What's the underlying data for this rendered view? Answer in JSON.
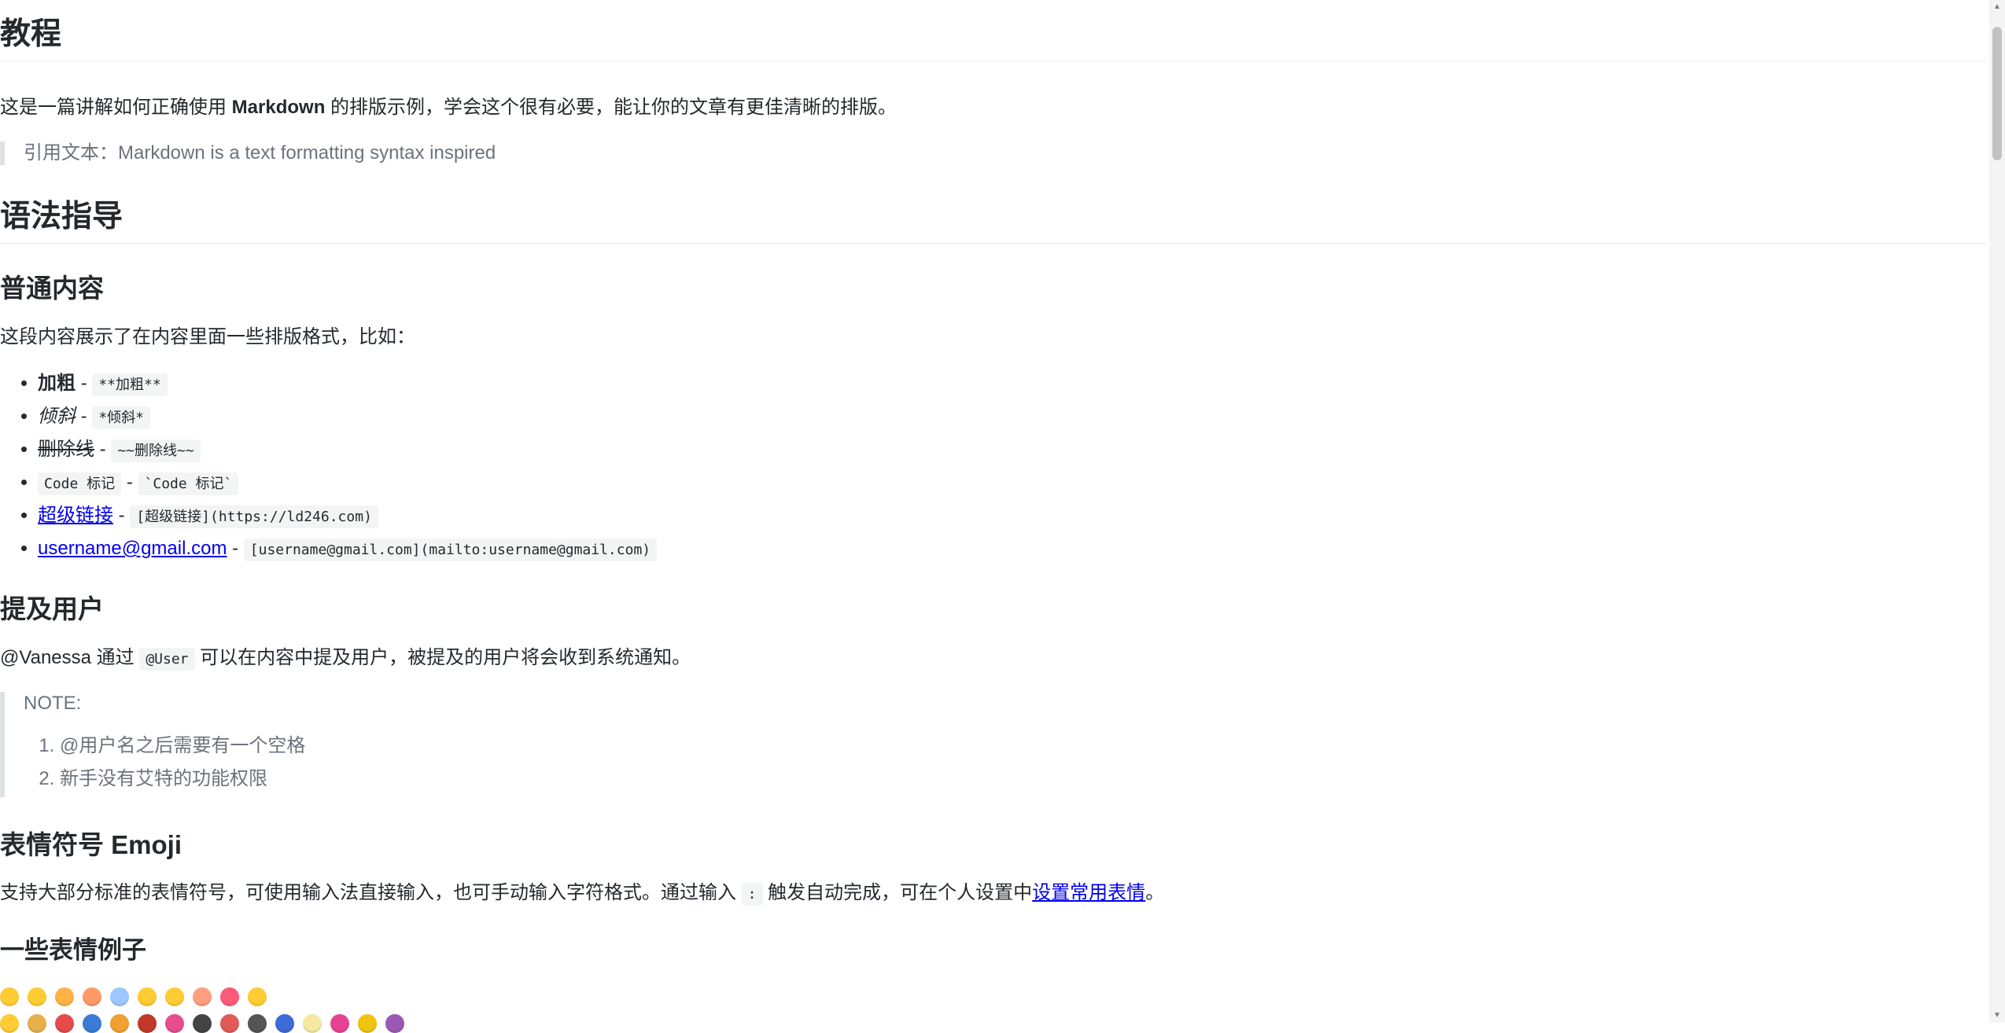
{
  "tutorial": {
    "title": "教程",
    "intro_before": "这是一篇讲解如何正确使用 ",
    "intro_bold": "Markdown",
    "intro_after": " 的排版示例，学会这个很有必要，能让你的文章有更佳清晰的排版。",
    "quote": "引用文本：Markdown is a text formatting syntax inspired"
  },
  "syntax_guide": {
    "title": "语法指导"
  },
  "normal_content": {
    "title": "普通内容",
    "description": "这段内容展示了在内容里面一些排版格式，比如：",
    "separator": " - ",
    "items": [
      {
        "label": "加粗",
        "code": "**加粗**"
      },
      {
        "label": "倾斜",
        "code": "*倾斜*"
      },
      {
        "label": "删除线",
        "code": "~~删除线~~"
      },
      {
        "label": "Code 标记",
        "code": "`Code 标记`"
      },
      {
        "label": "超级链接",
        "code": "[超级链接](https://ld246.com)"
      },
      {
        "label": "username@gmail.com",
        "code": "[username@gmail.com](mailto:username@gmail.com)"
      }
    ]
  },
  "mention": {
    "title": "提及用户",
    "text_before": "@Vanessa 通过 ",
    "code": "@User",
    "text_after": " 可以在内容中提及用户，被提及的用户将会收到系统通知。",
    "note_label": "NOTE:",
    "notes": [
      "@用户名之后需要有一个空格",
      "新手没有艾特的功能权限"
    ]
  },
  "emoji": {
    "title": "表情符号 Emoji",
    "text_before": "支持大部分标准的表情符号，可使用输入法直接输入，也可手动输入字符格式。通过输入 ",
    "code": ":",
    "text_middle": " 触发自动完成，可在个人设置中",
    "link": "设置常用表情",
    "text_after": "。",
    "examples_title": "一些表情例子"
  }
}
